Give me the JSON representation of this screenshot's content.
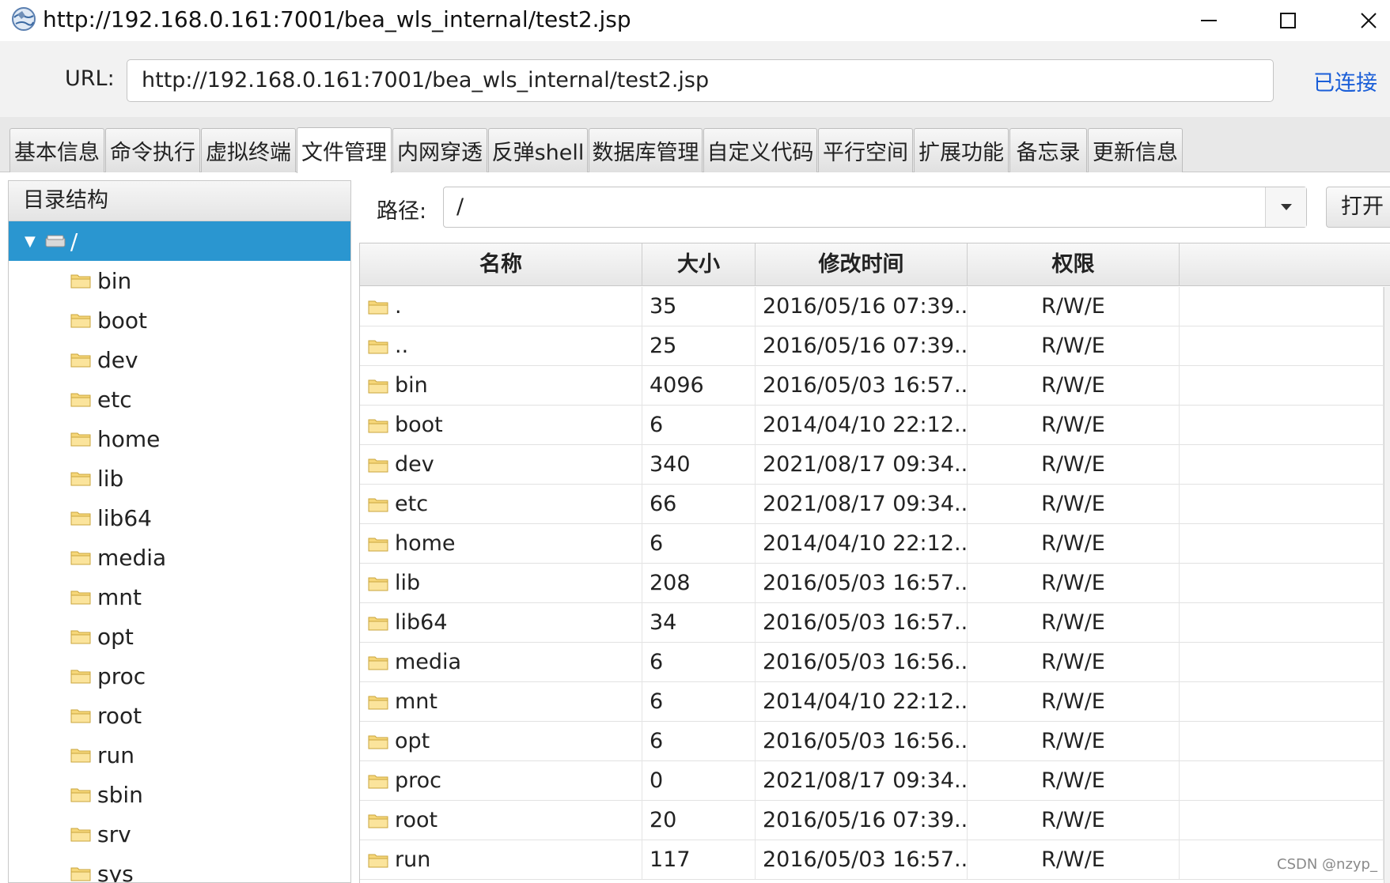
{
  "window": {
    "title": "http://192.168.0.161:7001/bea_wls_internal/test2.jsp",
    "icon": "globe-icon"
  },
  "urlbar": {
    "label": "URL:",
    "value": "http://192.168.0.161:7001/bea_wls_internal/test2.jsp",
    "status": "已连接",
    "status_color": "#1a5ed8"
  },
  "tabs": [
    {
      "label": "基本信息"
    },
    {
      "label": "命令执行"
    },
    {
      "label": "虚拟终端"
    },
    {
      "label": "文件管理",
      "active": true
    },
    {
      "label": "内网穿透"
    },
    {
      "label": "反弹shell"
    },
    {
      "label": "数据库管理"
    },
    {
      "label": "自定义代码"
    },
    {
      "label": "平行空间"
    },
    {
      "label": "扩展功能"
    },
    {
      "label": "备忘录"
    },
    {
      "label": "更新信息"
    }
  ],
  "sidebar": {
    "title": "目录结构",
    "root": "/",
    "selection_color": "#2a96d0",
    "items": [
      "bin",
      "boot",
      "dev",
      "etc",
      "home",
      "lib",
      "lib64",
      "media",
      "mnt",
      "opt",
      "proc",
      "root",
      "run",
      "sbin",
      "srv",
      "sys"
    ]
  },
  "path": {
    "label": "路径:",
    "value": "/",
    "open_label": "打开"
  },
  "table": {
    "headers": {
      "name": "名称",
      "size": "大小",
      "time": "修改时间",
      "perm": "权限"
    },
    "rows": [
      {
        "name": ".",
        "size": "35",
        "time": "2016/05/16 07:39...",
        "perm": "R/W/E"
      },
      {
        "name": "..",
        "size": "25",
        "time": "2016/05/16 07:39...",
        "perm": "R/W/E"
      },
      {
        "name": "bin",
        "size": "4096",
        "time": "2016/05/03 16:57...",
        "perm": "R/W/E"
      },
      {
        "name": "boot",
        "size": "6",
        "time": "2014/04/10 22:12...",
        "perm": "R/W/E"
      },
      {
        "name": "dev",
        "size": "340",
        "time": "2021/08/17 09:34...",
        "perm": "R/W/E"
      },
      {
        "name": "etc",
        "size": "66",
        "time": "2021/08/17 09:34...",
        "perm": "R/W/E"
      },
      {
        "name": "home",
        "size": "6",
        "time": "2014/04/10 22:12...",
        "perm": "R/W/E"
      },
      {
        "name": "lib",
        "size": "208",
        "time": "2016/05/03 16:57...",
        "perm": "R/W/E"
      },
      {
        "name": "lib64",
        "size": "34",
        "time": "2016/05/03 16:57...",
        "perm": "R/W/E"
      },
      {
        "name": "media",
        "size": "6",
        "time": "2016/05/03 16:56...",
        "perm": "R/W/E"
      },
      {
        "name": "mnt",
        "size": "6",
        "time": "2014/04/10 22:12...",
        "perm": "R/W/E"
      },
      {
        "name": "opt",
        "size": "6",
        "time": "2016/05/03 16:56...",
        "perm": "R/W/E"
      },
      {
        "name": "proc",
        "size": "0",
        "time": "2021/08/17 09:34...",
        "perm": "R/W/E"
      },
      {
        "name": "root",
        "size": "20",
        "time": "2016/05/16 07:39...",
        "perm": "R/W/E"
      },
      {
        "name": "run",
        "size": "117",
        "time": "2016/05/03 16:57...",
        "perm": "R/W/E"
      }
    ]
  },
  "watermark": "CSDN @nzyp_"
}
